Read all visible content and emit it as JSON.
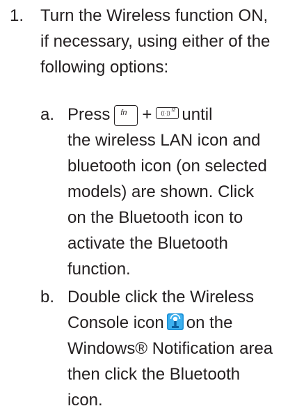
{
  "step": {
    "number": "1.",
    "text": "Turn the Wireless function ON, if necessary, using either of the following options:"
  },
  "option_a": {
    "letter": "a.",
    "press": "Press",
    "fn_key": "fn",
    "plus": "+",
    "f2_key_sub": "f2",
    "until": "until",
    "rest": "the wireless LAN icon and bluetooth icon (on selected models) are shown. Click on the Bluetooth icon to activate the Bluetooth function."
  },
  "option_b": {
    "letter": "b.",
    "before_icon": "Double click the Wireless Console icon",
    "after_icon": "on the Windows® Notification area then click the Bluetooth icon."
  },
  "icons": {
    "fn_key": "fn-key-icon",
    "f2_key": "f2-wireless-key-icon",
    "wireless_console": "wireless-console-icon"
  },
  "colors": {
    "text": "#231f20",
    "console_icon_blue": "#1a8fd6",
    "console_icon_dark": "#0b5e9e"
  }
}
